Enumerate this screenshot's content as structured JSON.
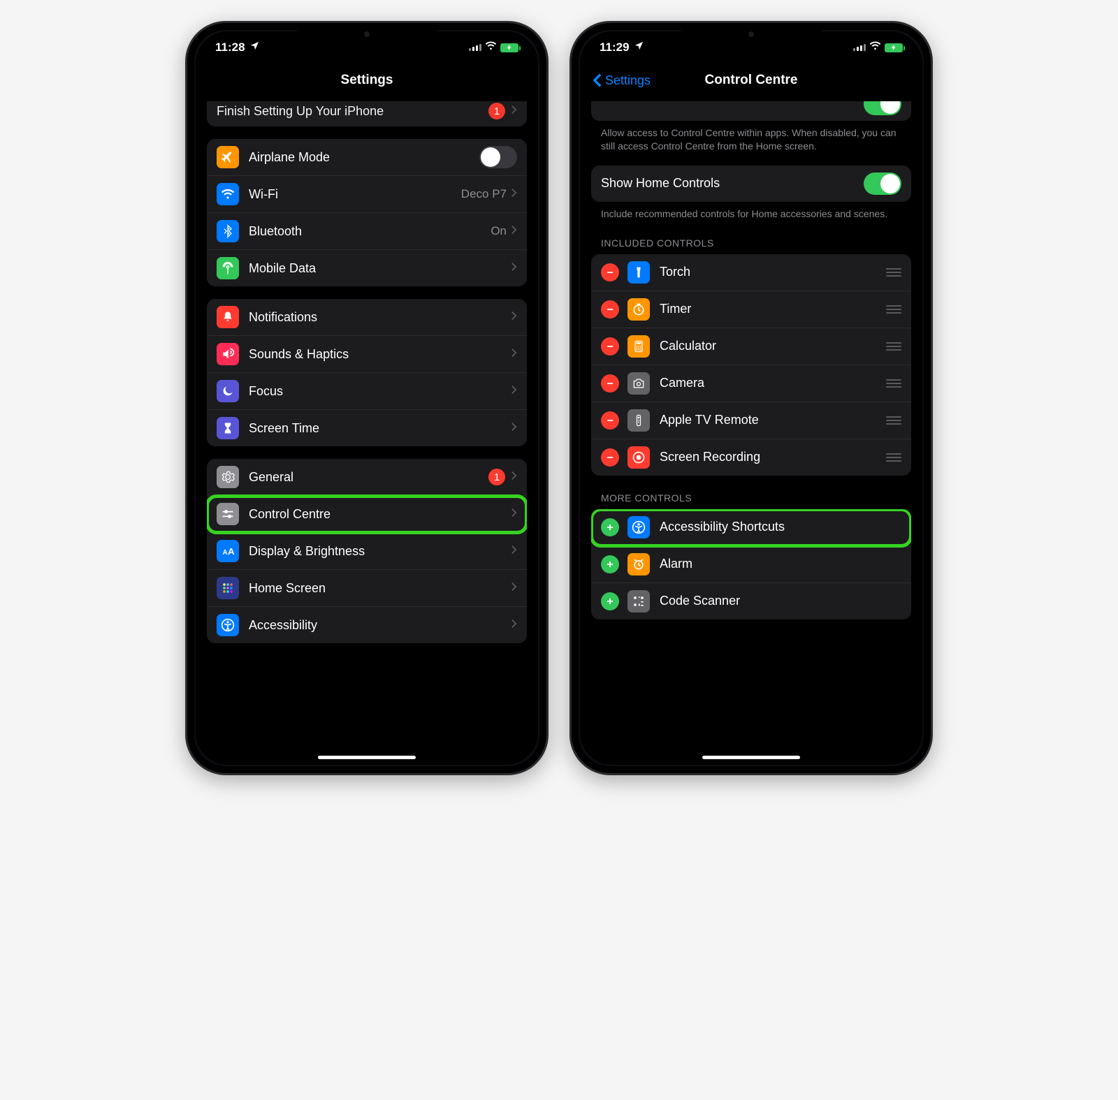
{
  "left": {
    "time": "11:28",
    "nav_title": "Settings",
    "partial_row": {
      "label": "Finish Setting Up Your iPhone",
      "badge": "1"
    },
    "group1": {
      "airplane": "Airplane Mode",
      "wifi": "Wi-Fi",
      "wifi_value": "Deco P7",
      "bluetooth": "Bluetooth",
      "bluetooth_value": "On",
      "mobile": "Mobile Data"
    },
    "group2": {
      "notifications": "Notifications",
      "sounds": "Sounds & Haptics",
      "focus": "Focus",
      "screentime": "Screen Time"
    },
    "group3": {
      "general": "General",
      "general_badge": "1",
      "control_centre": "Control Centre",
      "display": "Display & Brightness",
      "home": "Home Screen",
      "accessibility": "Accessibility"
    }
  },
  "right": {
    "time": "11:29",
    "nav_back": "Settings",
    "nav_title": "Control Centre",
    "access_footer": "Allow access to Control Centre within apps. When disabled, you can still access Control Centre from the Home screen.",
    "home_controls": "Show Home Controls",
    "home_footer": "Include recommended controls for Home accessories and scenes.",
    "included_header": "INCLUDED CONTROLS",
    "included": {
      "torch": "Torch",
      "timer": "Timer",
      "calculator": "Calculator",
      "camera": "Camera",
      "tv": "Apple TV Remote",
      "recording": "Screen Recording"
    },
    "more_header": "MORE CONTROLS",
    "more": {
      "accessibility": "Accessibility Shortcuts",
      "alarm": "Alarm",
      "scanner": "Code Scanner"
    }
  }
}
